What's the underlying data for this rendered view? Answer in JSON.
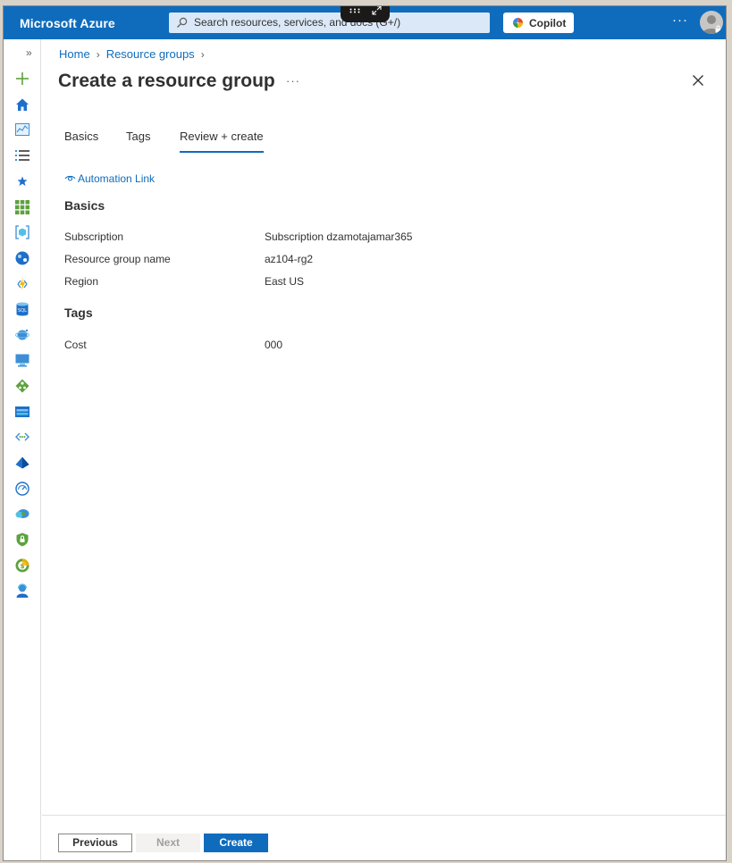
{
  "topbar": {
    "brand": "Microsoft Azure",
    "search_placeholder": "Search resources, services, and docs (G+/)",
    "copilot_label": "Copilot",
    "more_label": "···"
  },
  "rail": {
    "expand_label": "»",
    "icons": [
      "create-resource-icon",
      "home-icon",
      "dashboard-icon",
      "all-services-icon",
      "favorites-star-icon",
      "all-resources-icon",
      "resource-groups-icon",
      "app-services-icon",
      "function-app-icon",
      "sql-database-icon",
      "cosmos-db-icon",
      "virtual-machines-icon",
      "load-balancer-icon",
      "storage-accounts-icon",
      "virtual-networks-icon",
      "entra-id-icon",
      "monitor-icon",
      "advisor-icon",
      "defender-icon",
      "cost-management-icon",
      "help-support-icon"
    ]
  },
  "breadcrumb": {
    "items": [
      "Home",
      "Resource groups"
    ]
  },
  "page": {
    "title": "Create a resource group",
    "title_more": "···"
  },
  "tabs": [
    {
      "label": "Basics",
      "active": false
    },
    {
      "label": "Tags",
      "active": false
    },
    {
      "label": "Review + create",
      "active": true
    }
  ],
  "automation_link": "Automation Link",
  "basics": {
    "heading": "Basics",
    "rows": [
      {
        "label": "Subscription",
        "value": "Subscription dzamotajamar365"
      },
      {
        "label": "Resource group name",
        "value": "az104-rg2"
      },
      {
        "label": "Region",
        "value": "East US"
      }
    ]
  },
  "tags": {
    "heading": "Tags",
    "rows": [
      {
        "label": "Cost",
        "value": "000"
      }
    ]
  },
  "footer": {
    "previous_label": "Previous",
    "next_label": "Next",
    "create_label": "Create"
  },
  "colors": {
    "accent": "#0f6cbd",
    "text": "#323130",
    "disabled": "#a19f9d"
  }
}
